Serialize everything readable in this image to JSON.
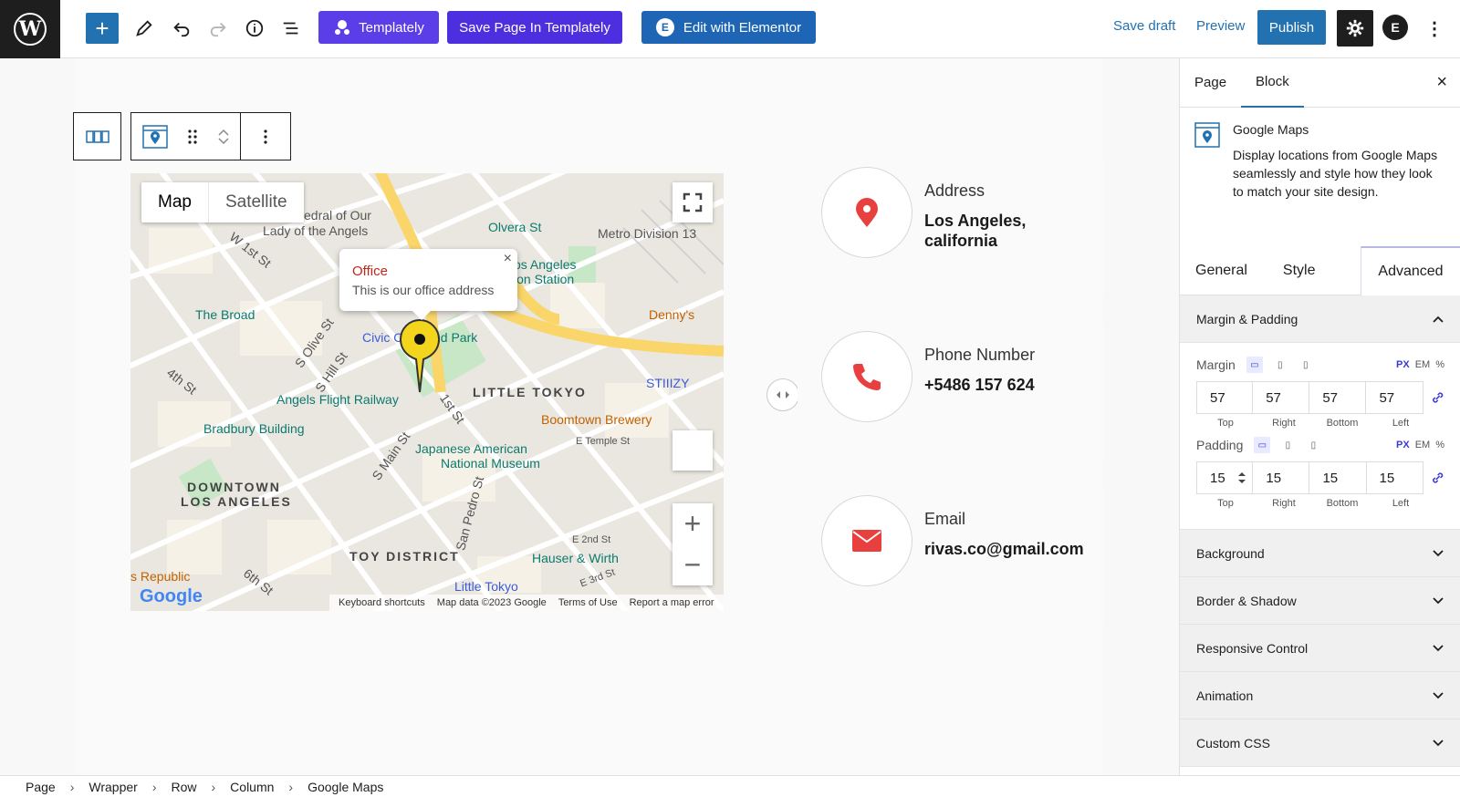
{
  "topbar": {
    "logo_letter": "W",
    "add_label": "+",
    "templately_label": "Templately",
    "save_templately_label": "Save Page In Templately",
    "elementor_label": "Edit with Elementor",
    "elementor_icon": "E",
    "save_draft_label": "Save draft",
    "preview_label": "Preview",
    "publish_label": "Publish",
    "account_letter": "E",
    "kebab": "⋮",
    "accent": "#2271b1"
  },
  "map": {
    "type_map": "Map",
    "type_satellite": "Satellite",
    "info_title": "Office",
    "info_desc": "This is our office address",
    "info_close": "×",
    "zoom_in": "+",
    "zoom_out": "−",
    "footer_shortcuts": "Keyboard shortcuts",
    "footer_data": "Map data ©2023 Google",
    "footer_terms": "Terms of Use",
    "footer_report": "Report a map error",
    "google": "Google",
    "labels": {
      "cathedral": "edral of Our",
      "lady": "Lady of the Angels",
      "olvera": "Olvera St",
      "metro": "Metro Division 13",
      "w1st": "W 1st St",
      "la_station": "os Angeles",
      "station": "ion Station",
      "broad": "The Broad",
      "dennys": "Denny's",
      "civic": "Civic C",
      "park": "nd Park",
      "olive": "S Olive St",
      "hill": "S Hill St",
      "fourth": "4th St",
      "little_tokyo": "LITTLE TOKYO",
      "stiizy": "STIIIZY",
      "angels_flight": "Angels Flight Railway",
      "first": "1st St",
      "bradbury": "Bradbury Building",
      "boomtown": "Boomtown Brewery",
      "etemple": "E Temple St",
      "main": "S Main St",
      "jam1": "Japanese American",
      "jam2": "National Museum",
      "downtown1": "DOWNTOWN",
      "downtown2": "LOS ANGELES",
      "pedro": "San Pedro St",
      "toy": "TOY DISTRICT",
      "e2nd": "E 2nd St",
      "hauser": "Hauser & Wirth",
      "republic": "s Republic",
      "sixth": "6th St",
      "little_tokyo2": "Little Tokyo",
      "e3rd": "E 3rd St"
    }
  },
  "contacts": [
    {
      "label": "Address",
      "value": "Los Angeles, california"
    },
    {
      "label": "Phone Number",
      "value": "+5486 157 624"
    },
    {
      "label": "Email",
      "value": "rivas.co@gmail.com"
    }
  ],
  "contact_icon_color": "#e8403f",
  "breadcrumb": [
    "Page",
    "Wrapper",
    "Row",
    "Column",
    "Google Maps"
  ],
  "sidebar": {
    "tab_page": "Page",
    "tab_block": "Block",
    "close": "×",
    "block_name": "Google Maps",
    "block_desc": "Display locations from Google Maps seamlessly and style how they look to match your site design.",
    "tab_general": "General",
    "tab_style": "Style",
    "tab_advanced": "Advanced",
    "section_margin_padding": "Margin & Padding",
    "margin_label": "Margin",
    "padding_label": "Padding",
    "unit_px": "PX",
    "unit_em": "EM",
    "unit_pct": "%",
    "margin": {
      "top": "57",
      "right": "57",
      "bottom": "57",
      "left": "57"
    },
    "padding": {
      "top": "15",
      "right": "15",
      "bottom": "15",
      "left": "15"
    },
    "side_top": "Top",
    "side_right": "Right",
    "side_bottom": "Bottom",
    "side_left": "Left",
    "sections": [
      "Background",
      "Border & Shadow",
      "Responsive Control",
      "Animation",
      "Custom CSS"
    ]
  }
}
